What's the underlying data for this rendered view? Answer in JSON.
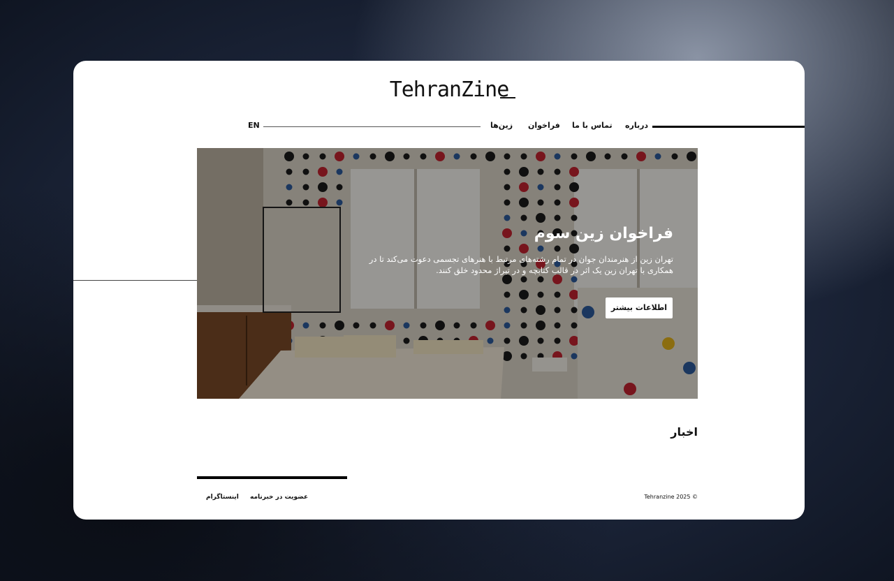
{
  "header": {
    "logo_text": "TehranZine",
    "nav": [
      {
        "label": "درباره"
      },
      {
        "label": "تماس با ما"
      },
      {
        "label": "فراخوان"
      },
      {
        "label": "زین‌ها"
      }
    ],
    "lang_label": "EN"
  },
  "hero": {
    "title": "فراخوان زین سوم",
    "body": "تهران زین از هنرمندان جوان در تمام رشته‌های مرتبط با هنرهای تجسمی دعوت می‌کند تا در همکاری با تهران زین یک اثر در قالب کتابچه و در تیراژ محدود خلق کنند.",
    "button_label": "اطلاعات بیشتر"
  },
  "news": {
    "title": "اخبار"
  },
  "footer": {
    "links": [
      {
        "label": "عضویت در خبرنامه"
      },
      {
        "label": "اینستاگرام"
      }
    ],
    "copyright": "Tehranzine 2025 ©"
  },
  "colors": {
    "card_bg": "#ffffff",
    "text": "#111111",
    "button_bg": "#ffffff"
  }
}
